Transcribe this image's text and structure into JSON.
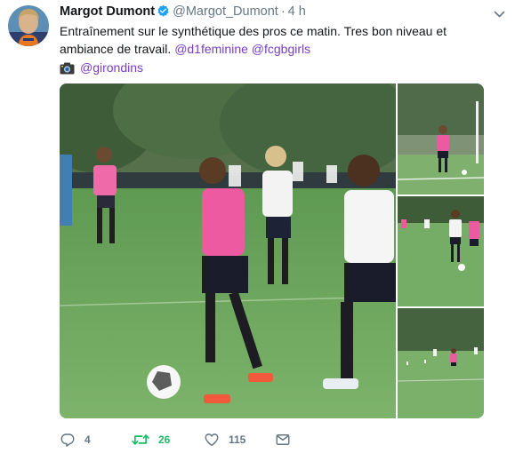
{
  "tweet": {
    "author_name": "Margot Dumont",
    "author_handle": "@Margot_Dumont",
    "separator": "·",
    "time": "4 h",
    "text_line1": "Entraînement sur le synthétique des pros ce matin. Tres bon niveau et",
    "text_line2_prefix": "ambiance de travail. ",
    "mention1": "@d1feminine",
    "mention2": "@fcgbgirls",
    "location_mention": "@girondins",
    "icons": {
      "verified": "verified-badge-icon",
      "caret": "chevron-down-icon",
      "camera": "camera-icon"
    }
  },
  "actions": {
    "reply_count": "4",
    "retweet_count": "26",
    "like_count": "115"
  },
  "colors": {
    "text": "#14171a",
    "muted": "#657786",
    "link": "#7a3ec4",
    "retweet_active": "#17bf63",
    "verified": "#1da1f2"
  }
}
